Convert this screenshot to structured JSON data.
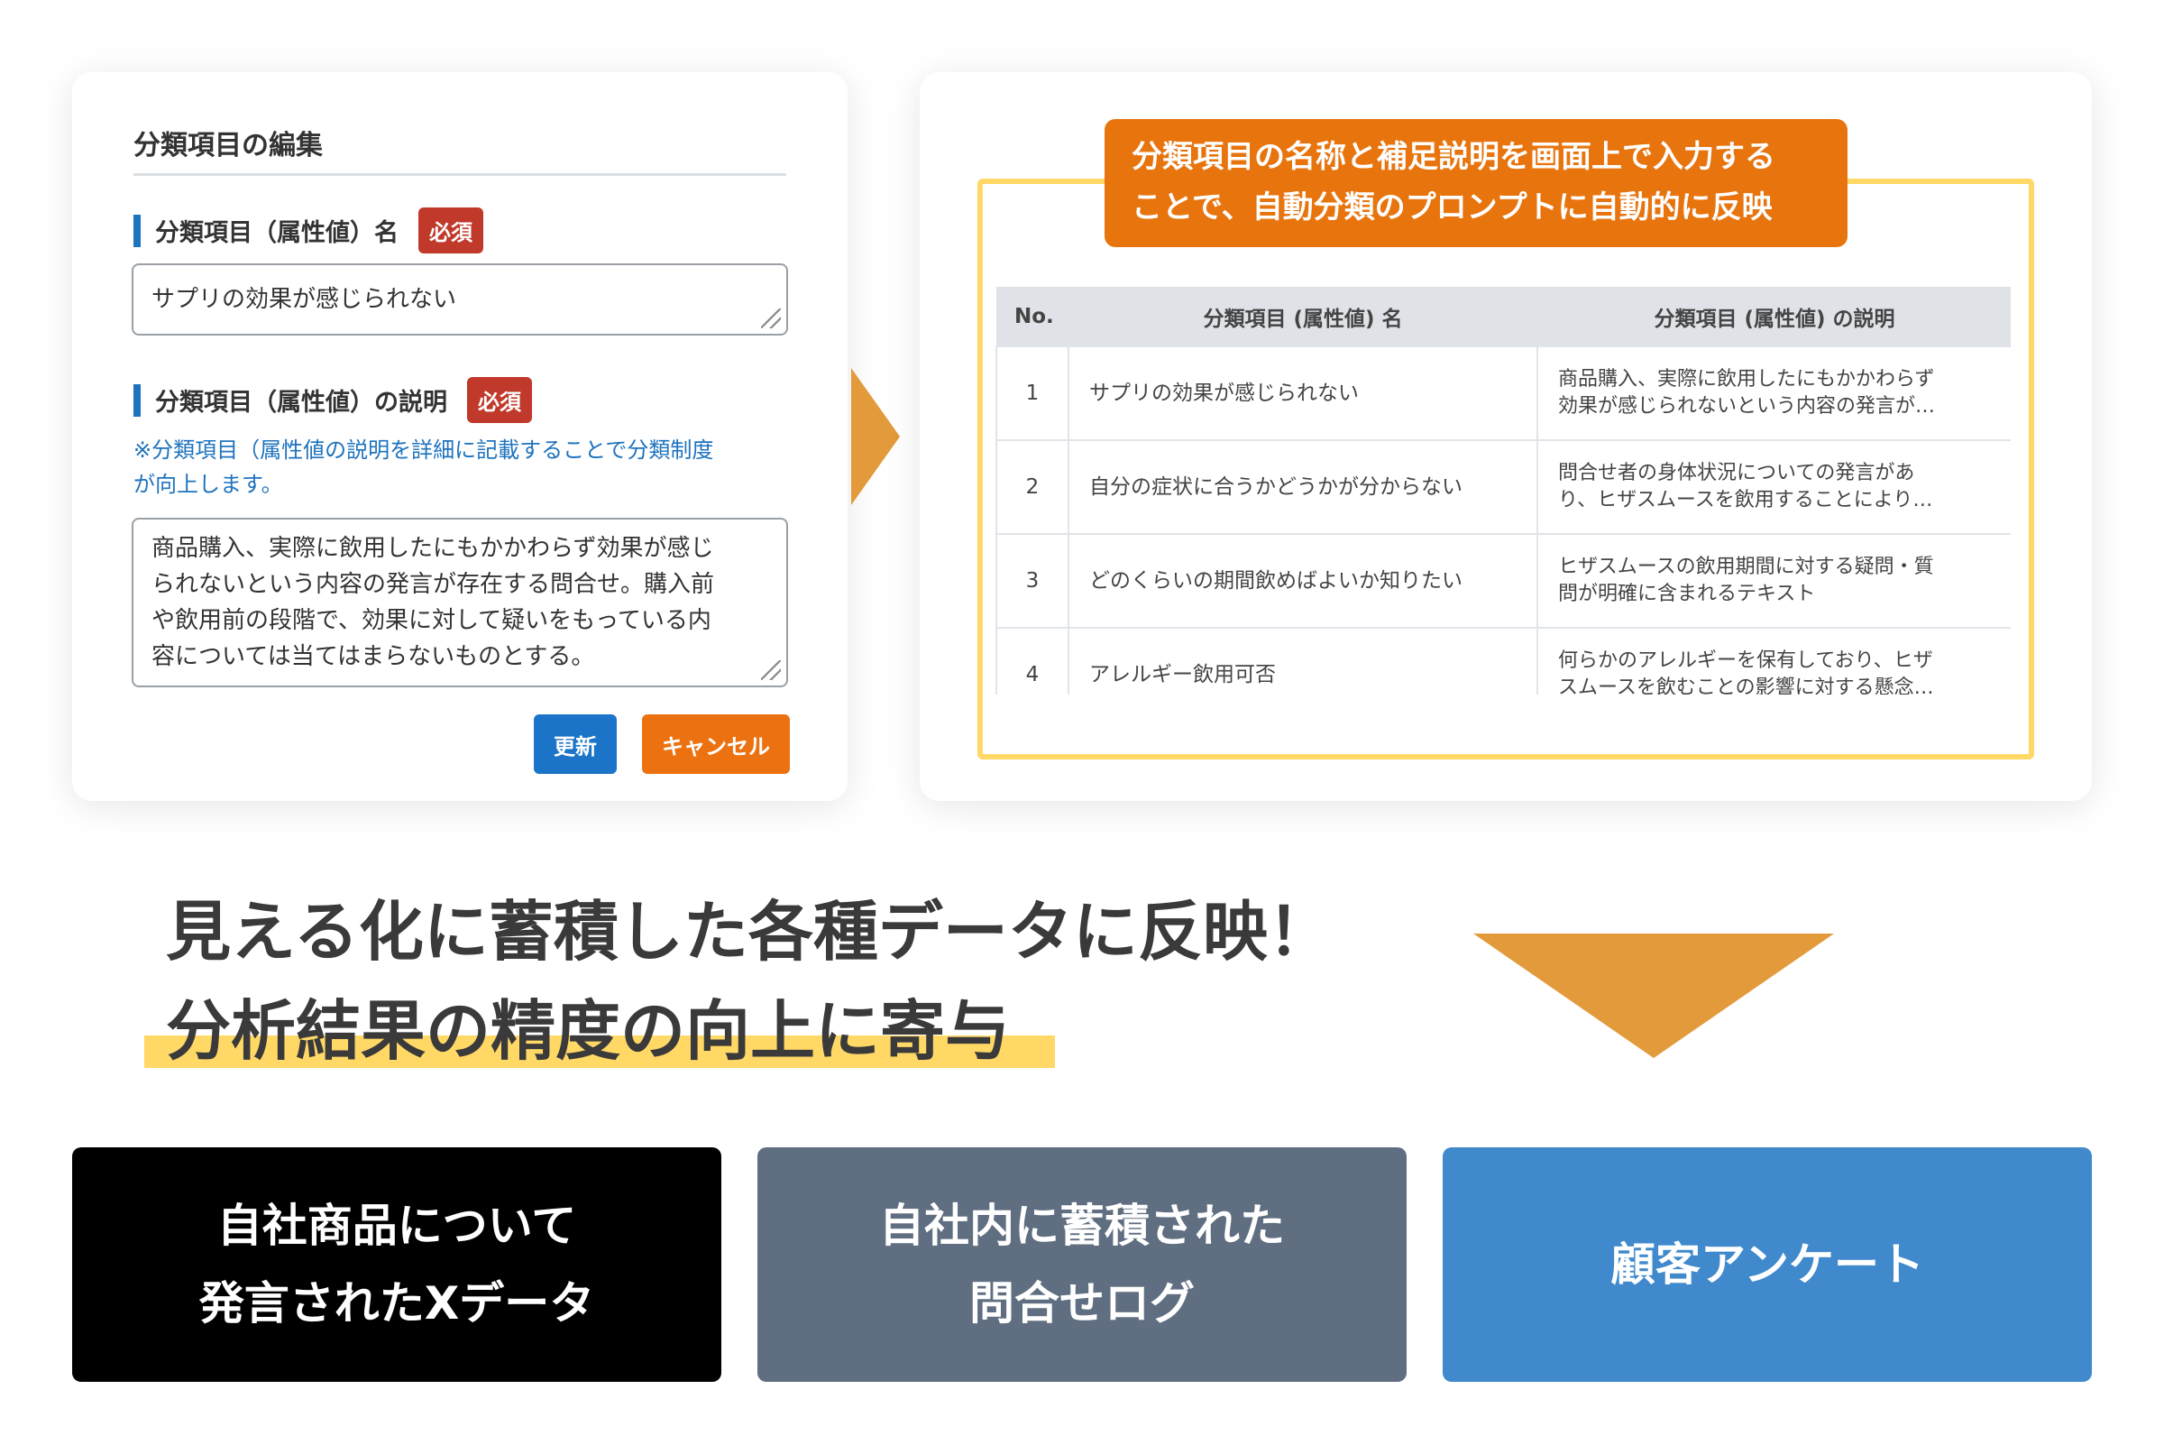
{
  "edit_form": {
    "title": "分類項目の編集",
    "name_label": "分類項目（属性値）名",
    "required_badge": "必須",
    "name_value": "サプリの効果が感じられない",
    "desc_label": "分類項目（属性値）の説明",
    "hint_line1": "※分類項目（属性値の説明を詳細に記載することで分類制度",
    "hint_line2": "が向上します。",
    "desc_lines": [
      "商品購入、実際に飲用したにもかかわらず効果が感じ",
      "られないという内容の発言が存在する問合せ。購入前",
      "や飲用前の段階で、効果に対して疑いをもっている内",
      "容については当てはまらないものとする。"
    ],
    "update_button": "更新",
    "cancel_button": "キャンセル"
  },
  "callout": {
    "line1": "分類項目の名称と補足説明を画面上で入力する",
    "line2": "ことで、自動分類のプロンプトに自動的に反映"
  },
  "table": {
    "headers": [
      "No.",
      "分類項目 (属性値) 名",
      "分類項目 (属性値) の説明"
    ],
    "rows": [
      {
        "no": "1",
        "name": "サプリの効果が感じられない",
        "desc1": "商品購入、実際に飲用したにもかかわらず",
        "desc2": "効果が感じられないという内容の発言が…"
      },
      {
        "no": "2",
        "name": "自分の症状に合うかどうかが分からない",
        "desc1": "問合せ者の身体状況についての発言があ",
        "desc2": "り、ヒザスムースを飲用することにより…"
      },
      {
        "no": "3",
        "name": "どのくらいの期間飲めばよいか知りたい",
        "desc1": "ヒザスムースの飲用期間に対する疑問・質",
        "desc2": "問が明確に含まれるテキスト"
      },
      {
        "no": "4",
        "name": "アレルギー飲用可否",
        "desc1": "何らかのアレルギーを保有しており、ヒザ",
        "desc2": "スムースを飲むことの影響に対する懸念…"
      }
    ]
  },
  "headline": {
    "line1": "見える化に蓄積した各種データに反映！",
    "line2": "分析結果の精度の向上に寄与"
  },
  "sources": {
    "x_data": {
      "line1": "自社商品について",
      "line2": "発言されたXデータ"
    },
    "inquiry_log": {
      "line1": "自社内に蓄積された",
      "line2": "問合せログ"
    },
    "survey": {
      "line1": "顧客アンケート"
    }
  },
  "colors": {
    "accent_orange": "#e8740e",
    "arrow_orange": "#e29a3a",
    "highlight_yellow": "#ffd866",
    "primary_blue": "#1b74c7",
    "required_red": "#c0392b",
    "slate": "#5f6e80",
    "survey_blue": "#3f89cc"
  }
}
